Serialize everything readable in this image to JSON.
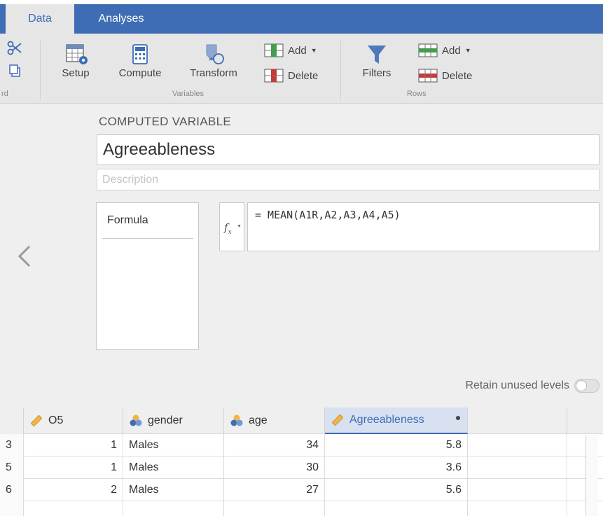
{
  "tabs": {
    "data": "Data",
    "analyses": "Analyses"
  },
  "ribbon": {
    "clipboard_label": "rd",
    "setup": "Setup",
    "compute": "Compute",
    "transform": "Transform",
    "var_add": "Add",
    "var_delete": "Delete",
    "variables_label": "Variables",
    "filters": "Filters",
    "row_add": "Add",
    "row_delete": "Delete",
    "rows_label": "Rows"
  },
  "editor": {
    "title": "COMPUTED VARIABLE",
    "name": "Agreeableness",
    "description_placeholder": "Description",
    "formula_tab": "Formula",
    "formula": "= MEAN(A1R,A2,A3,A4,A5)",
    "retain_label": "Retain unused levels",
    "retain_on": false
  },
  "columns": [
    {
      "name": "O5",
      "icon": "ruler-icon"
    },
    {
      "name": "gender",
      "icon": "nominal-icon"
    },
    {
      "name": "age",
      "icon": "nominal-icon"
    },
    {
      "name": "Agreeableness",
      "icon": "ruler-icon",
      "selected": true
    }
  ],
  "rows": [
    {
      "rownum": "3",
      "o5": "1",
      "gender": "Males",
      "age": "34",
      "agreeableness": "5.8"
    },
    {
      "rownum": "5",
      "o5": "1",
      "gender": "Males",
      "age": "30",
      "agreeableness": "3.6"
    },
    {
      "rownum": "6",
      "o5": "2",
      "gender": "Males",
      "age": "27",
      "agreeableness": "5.6"
    }
  ],
  "colors": {
    "accent": "#3e6db5",
    "ribbon_bg": "#e6e6e6",
    "editor_bg": "#efefef",
    "selected_header": "#d7e1f0"
  }
}
